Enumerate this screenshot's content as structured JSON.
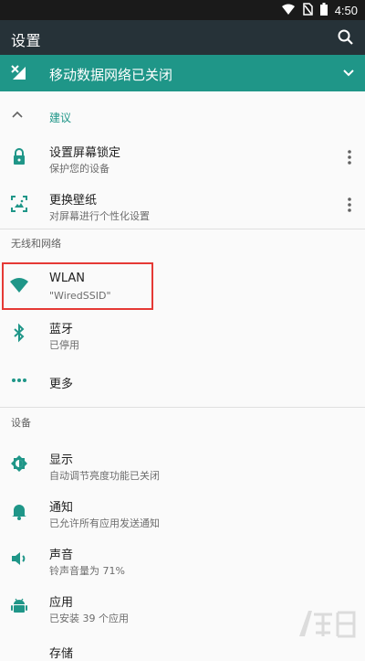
{
  "status_bar": {
    "time": "4:50"
  },
  "app_bar": {
    "title": "设置"
  },
  "banner": {
    "text": "移动数据网络已关闭"
  },
  "suggestions": {
    "header": "建议",
    "items": [
      {
        "title": "设置屏幕锁定",
        "subtitle": "保护您的设备"
      },
      {
        "title": "更换壁纸",
        "subtitle": "对屏幕进行个性化设置"
      }
    ]
  },
  "wireless": {
    "header": "无线和网络",
    "items": [
      {
        "title": "WLAN",
        "subtitle": "\"WiredSSID\""
      },
      {
        "title": "蓝牙",
        "subtitle": "已停用"
      },
      {
        "title": "更多",
        "subtitle": ""
      }
    ]
  },
  "device": {
    "header": "设备",
    "items": [
      {
        "title": "显示",
        "subtitle": "自动调节亮度功能已关闭"
      },
      {
        "title": "通知",
        "subtitle": "已允许所有应用发送通知"
      },
      {
        "title": "声音",
        "subtitle": "铃声音量为 71%"
      },
      {
        "title": "应用",
        "subtitle": "已安装 39 个应用"
      }
    ],
    "peek_title": "存储"
  },
  "colors": {
    "accent": "#1f9688",
    "appbar": "#263238",
    "highlight": "#e53935"
  }
}
